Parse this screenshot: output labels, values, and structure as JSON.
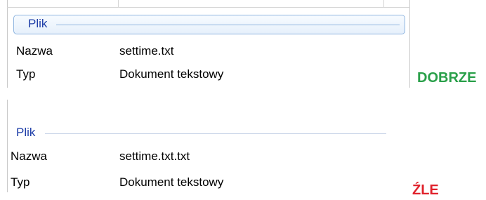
{
  "top_panel": {
    "group_label": "Plik",
    "rows": [
      {
        "name": "Nazwa",
        "value": "settime.txt"
      },
      {
        "name": "Typ",
        "value": "Dokument tekstowy"
      }
    ],
    "verdict": "DOBRZE",
    "verdict_color": "#2aa04a"
  },
  "bottom_panel": {
    "group_label": "Plik",
    "rows": [
      {
        "name": "Nazwa",
        "value": "settime.txt.txt"
      },
      {
        "name": "Typ",
        "value": "Dokument tekstowy"
      }
    ],
    "verdict": "ŹLE",
    "verdict_color": "#e0212b"
  },
  "group_accent": "#1e3ea8"
}
